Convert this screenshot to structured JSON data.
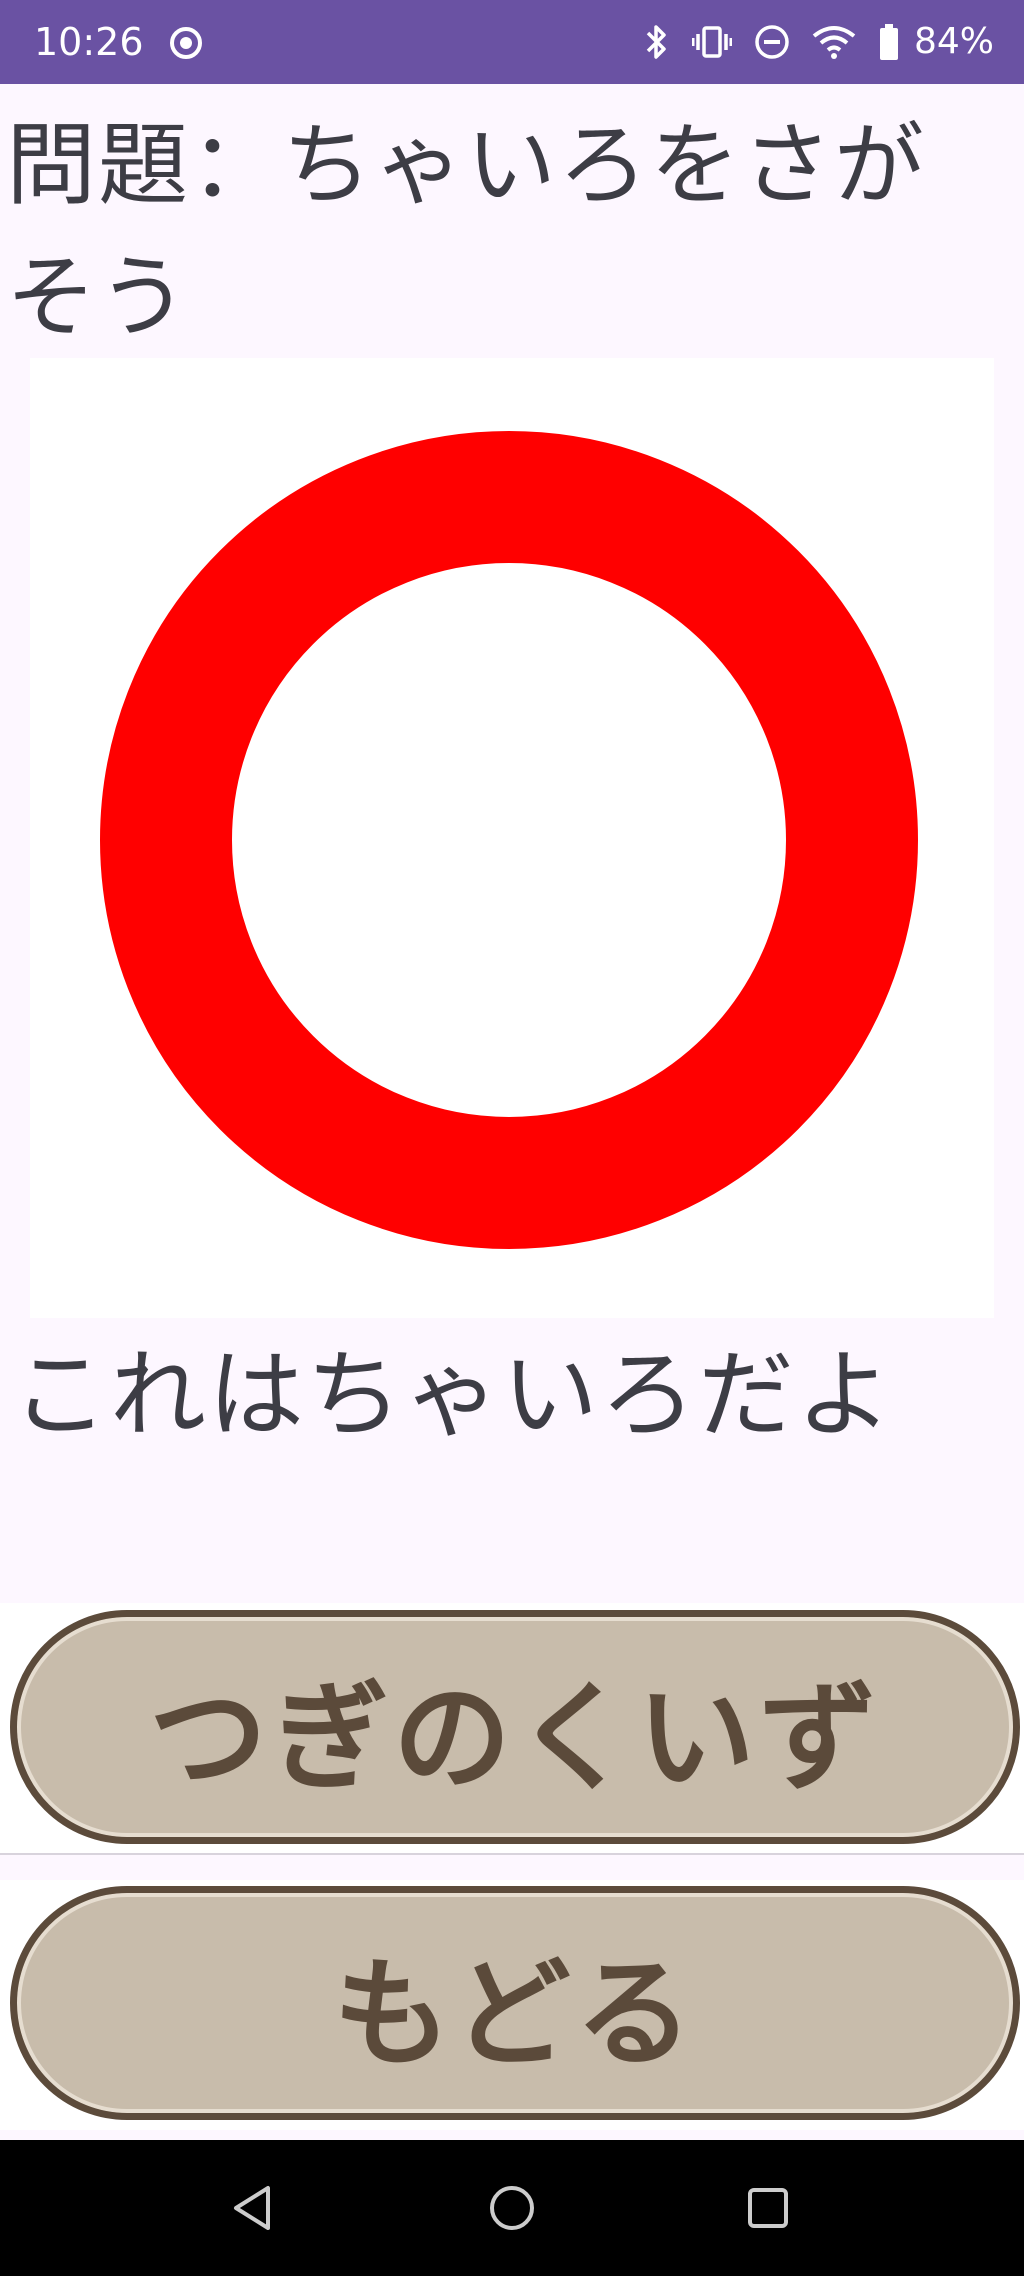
{
  "status_bar": {
    "time": "10:26",
    "battery_percent": "84%",
    "background_color": "#6a52a3",
    "icons": [
      "screen-record-icon",
      "bluetooth-icon",
      "vibrate-icon",
      "do-not-disturb-icon",
      "wifi-icon",
      "battery-icon"
    ]
  },
  "quiz": {
    "question": "問題：ちゃいろをさがそう",
    "image_icon": "red-ring-icon",
    "ring_color": "#ff0000",
    "answer": "これはちゃいろだよ"
  },
  "buttons": {
    "next_label": "つぎのくいず",
    "back_label": "もどる",
    "fill_color": "#c8bcab",
    "border_color": "#5c4b3b"
  },
  "nav_bar": {
    "icons": [
      "back-triangle-icon",
      "home-circle-icon",
      "recents-square-icon"
    ]
  }
}
